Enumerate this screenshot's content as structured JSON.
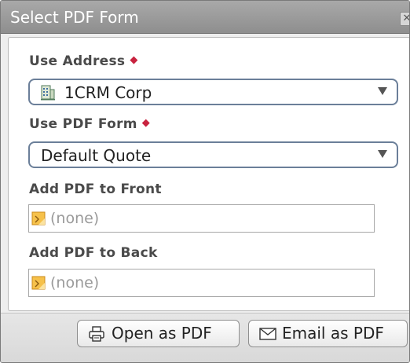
{
  "window": {
    "title": "Select PDF Form",
    "close_glyph": "✕"
  },
  "form": {
    "use_address": {
      "label": "Use Address",
      "value": "1CRM Corp",
      "required_marker": "◆",
      "icon": "building-icon"
    },
    "use_pdf_form": {
      "label": "Use PDF Form",
      "value": "Default Quote",
      "required_marker": "◆"
    },
    "add_pdf_front": {
      "label": "Add PDF to Front",
      "value": "(none)",
      "icon": "file-icon"
    },
    "add_pdf_back": {
      "label": "Add PDF to Back",
      "value": "(none)",
      "icon": "file-icon"
    }
  },
  "footer": {
    "open_pdf": {
      "label": "Open as PDF",
      "icon": "printer-icon"
    },
    "email_pdf": {
      "label": "Email as PDF",
      "icon": "envelope-icon"
    }
  },
  "colors": {
    "required": "#c8233f",
    "titlebar": "#9a9a9a",
    "select_border": "#6b7f99"
  }
}
